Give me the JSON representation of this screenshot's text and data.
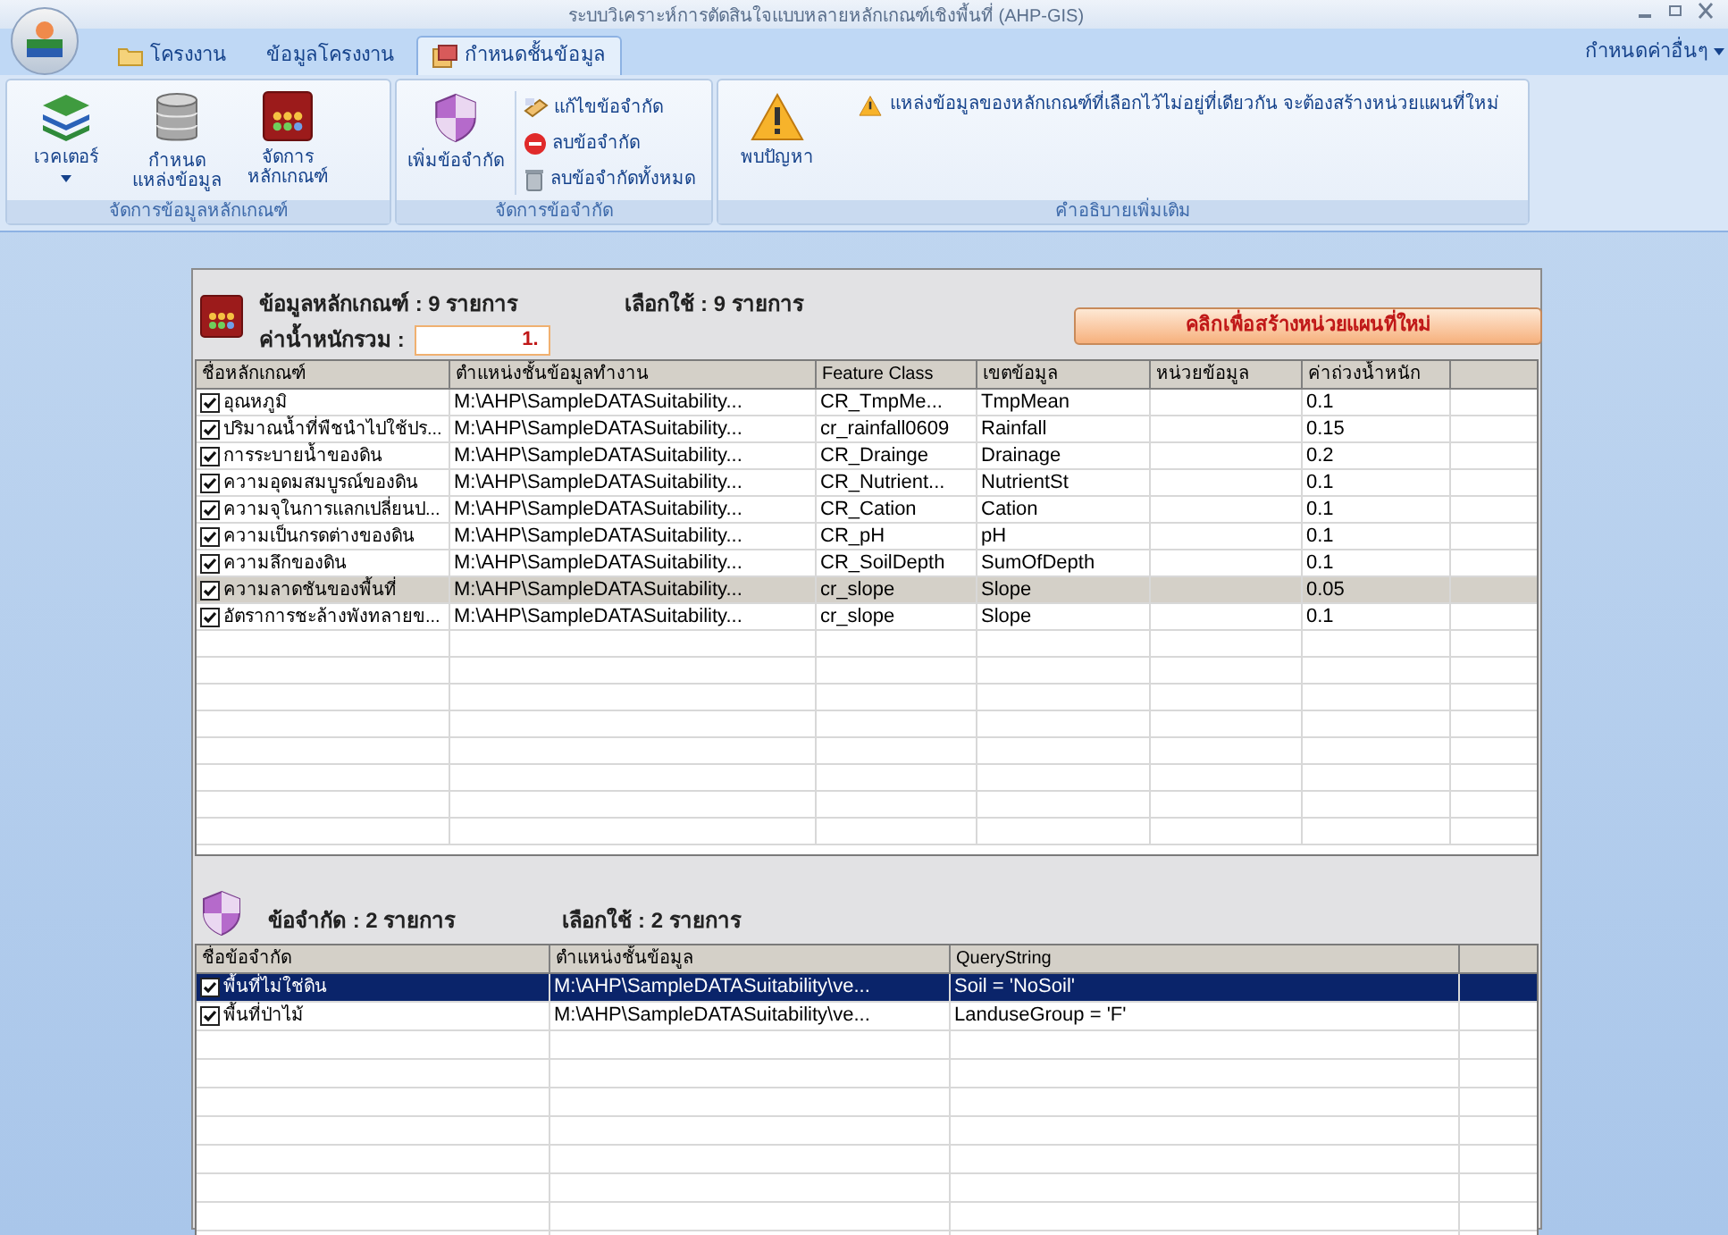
{
  "window": {
    "title": "ระบบวิเคราะห์การตัดสินใจแบบหลายหลักเกณฑ์เชิงพื้นที่ (AHP-GIS)"
  },
  "tabs": [
    {
      "label": "โครงงาน",
      "selected": false,
      "kind": "folder"
    },
    {
      "label": "ข้อมูลโครงงาน",
      "selected": false,
      "kind": "plain"
    },
    {
      "label": "กำหนดชั้นข้อมูล",
      "selected": true,
      "kind": "layers"
    }
  ],
  "options_menu": "กำหนดค่าอื่นๆ",
  "ribbon": [
    {
      "caption": "จัดการข้อมูลหลักเกณฑ์",
      "buttons": [
        {
          "label": "เวคเตอร์",
          "kind": "menu"
        },
        {
          "label": "กำหนด\nแหล่งข้อมูล",
          "kind": "large"
        },
        {
          "label": "จัดการ\nหลักเกณฑ์",
          "kind": "large"
        }
      ]
    },
    {
      "caption": "จัดการข้อจำกัด",
      "buttons": [
        {
          "label": "เพิ่มข้อจำกัด",
          "kind": "large"
        },
        {
          "label": "แก้ไขข้อจำกัด",
          "kind": "small"
        },
        {
          "label": "ลบข้อจำกัด",
          "kind": "small"
        },
        {
          "label": "ลบข้อจำกัดทั้งหมด",
          "kind": "small"
        }
      ]
    },
    {
      "caption": "คำอธิบายเพิ่มเติม",
      "buttons": [
        {
          "label": "พบปัญหา",
          "kind": "large"
        }
      ],
      "message": "แหล่งข้อมูลของหลักเกณฑ์ที่เลือกไว้ไม่อยู่ที่เดียวกัน จะต้องสร้างหน่วยแผนที่ใหม่"
    }
  ],
  "criteria": {
    "count": "ข้อมูลหลักเกณฑ์ : 9 รายการ",
    "selected_count": "เลือกใช้ : 9 รายการ",
    "total_weight_label": "ค่าน้ำหนักรวม :",
    "total_weight": "1.",
    "create_button": "คลิกเพื่อสร้างหน่วยแผนที่ใหม่",
    "focused": false,
    "columns": [
      "ชื่อหลักเกณฑ์",
      "ตำแหน่งชั้นข้อมูลทำงาน",
      "Feature Class",
      "เขตข้อมูล",
      "หน่วยข้อมูล",
      "ค่าถ่วงน้ำหนัก"
    ],
    "rows": [
      {
        "checked": true,
        "selected": false,
        "cells": [
          "อุณหภูมิ",
          "M:\\AHP\\SampleDATASuitability...",
          "CR_TmpMe...",
          "TmpMean",
          "",
          "0.1"
        ]
      },
      {
        "checked": true,
        "selected": false,
        "cells": [
          "ปริมาณน้ำที่พืชนำไปใช้ปร...",
          "M:\\AHP\\SampleDATASuitability...",
          "cr_rainfall0609",
          "Rainfall",
          "",
          "0.15"
        ]
      },
      {
        "checked": true,
        "selected": false,
        "cells": [
          "การระบายน้ำของดิน",
          "M:\\AHP\\SampleDATASuitability...",
          "CR_Drainge",
          "Drainage",
          "",
          "0.2"
        ]
      },
      {
        "checked": true,
        "selected": false,
        "cells": [
          "ความอุดมสมบูรณ์ของดิน",
          "M:\\AHP\\SampleDATASuitability...",
          "CR_Nutrient...",
          "NutrientSt",
          "",
          "0.1"
        ]
      },
      {
        "checked": true,
        "selected": false,
        "cells": [
          "ความจุในการแลกเปลี่ยนป...",
          "M:\\AHP\\SampleDATASuitability...",
          "CR_Cation",
          "Cation",
          "",
          "0.1"
        ]
      },
      {
        "checked": true,
        "selected": false,
        "cells": [
          "ความเป็นกรดต่างของดิน",
          "M:\\AHP\\SampleDATASuitability...",
          "CR_pH",
          "pH",
          "",
          "0.1"
        ]
      },
      {
        "checked": true,
        "selected": false,
        "cells": [
          "ความลึกของดิน",
          "M:\\AHP\\SampleDATASuitability...",
          "CR_SoilDepth",
          "SumOfDepth",
          "",
          "0.1"
        ]
      },
      {
        "checked": true,
        "selected": true,
        "cells": [
          "ความลาดชันของพื้นที่",
          "M:\\AHP\\SampleDATASuitability...",
          "cr_slope",
          "Slope",
          "",
          "0.05"
        ]
      },
      {
        "checked": true,
        "selected": false,
        "cells": [
          "อัตราการชะล้างพังทลายข...",
          "M:\\AHP\\SampleDATASuitability...",
          "cr_slope",
          "Slope",
          "",
          "0.1"
        ]
      }
    ]
  },
  "constraints": {
    "count": "ข้อจำกัด : 2 รายการ",
    "selected_count": "เลือกใช้ : 2 รายการ",
    "focused": true,
    "columns": [
      "ชื่อข้อจำกัด",
      "ตำแหน่งชั้นข้อมูล",
      "QueryString"
    ],
    "rows": [
      {
        "checked": true,
        "selected": true,
        "cells": [
          "พื้นที่ไม่ใช่ดิน",
          "M:\\AHP\\SampleDATASuitability\\ve...",
          "Soil = 'NoSoil'"
        ]
      },
      {
        "checked": true,
        "selected": false,
        "cells": [
          "พื้นที่ป่าไม้",
          "M:\\AHP\\SampleDATASuitability\\ve...",
          "LanduseGroup = 'F'"
        ]
      }
    ]
  }
}
